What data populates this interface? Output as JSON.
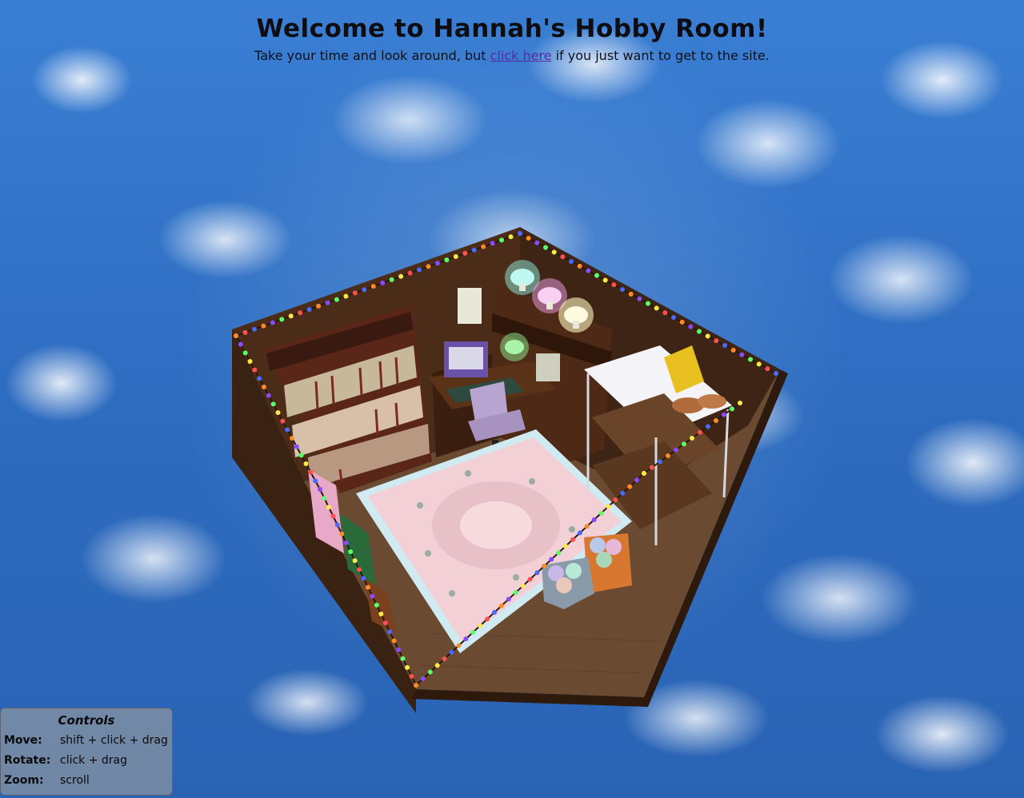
{
  "header": {
    "title": "Welcome to Hannah's Hobby Room!",
    "subtitle_before": "Take your time and look around, but ",
    "subtitle_link": "click here",
    "subtitle_after": " if you just want to get to the site."
  },
  "colors": {
    "sky": "#2f6fc4",
    "link": "#5a2aa0",
    "wall": "#4a2c18",
    "floor": "#6b4a32",
    "rug": "#f2d0d6",
    "controls_bg": "#8c96a0"
  },
  "controls": {
    "title": "Controls",
    "rows": [
      {
        "key": "Move",
        "value": "shift + click + drag"
      },
      {
        "key": "Rotate",
        "value": "click + drag"
      },
      {
        "key": "Zoom",
        "value": "scroll"
      }
    ]
  }
}
